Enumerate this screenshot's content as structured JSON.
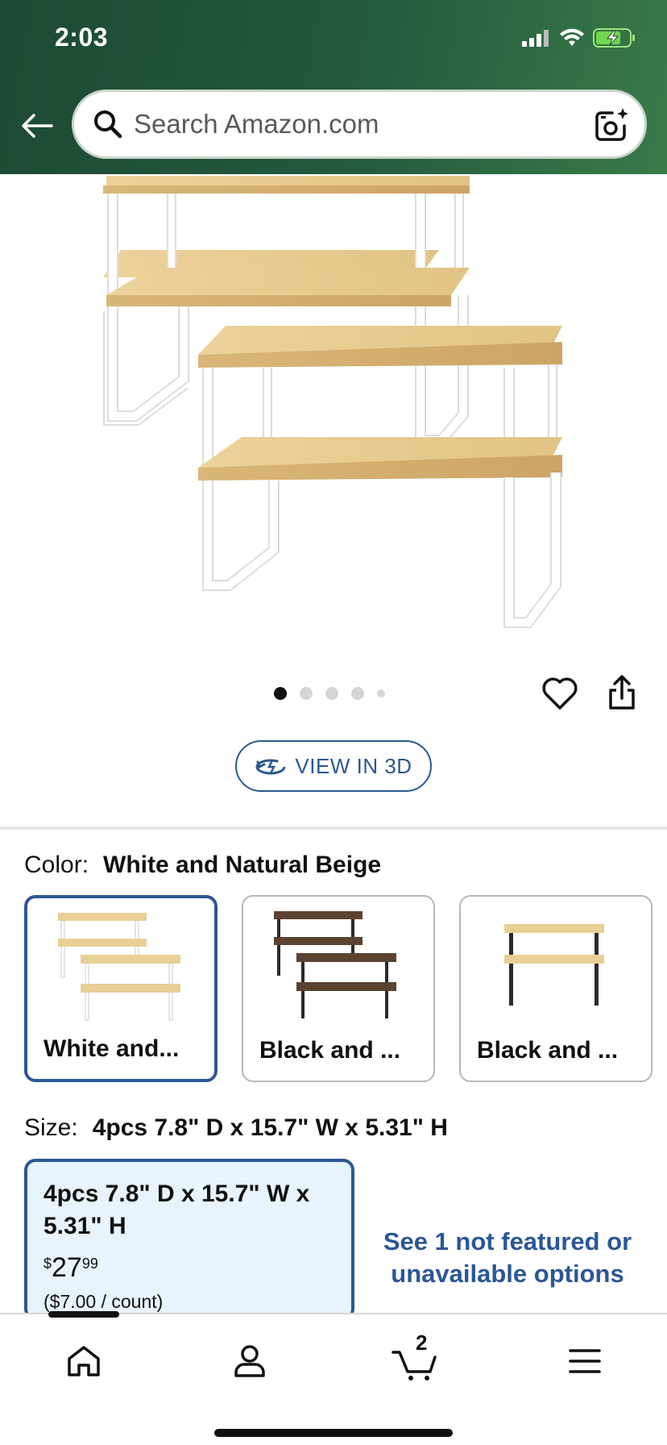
{
  "status_bar": {
    "time": "2:03"
  },
  "search": {
    "placeholder": "Search Amazon.com"
  },
  "product": {
    "image_alt": "Stackable kitchen cabinet shelf organizers, white and natural beige",
    "carousel": {
      "total": 5,
      "active": 1
    }
  },
  "actions": {
    "view_3d_label": "VIEW IN 3D"
  },
  "color": {
    "label": "Color:",
    "selected": "White and Natural Beige",
    "options": [
      {
        "label": "White and...",
        "wood": "#e8cf96",
        "frame": "#ffffff"
      },
      {
        "label": "Black and ...",
        "wood": "#5b4331",
        "frame": "#2a2a2a"
      },
      {
        "label": "Black and ...",
        "wood": "#e8cf96",
        "frame": "#2a2a2a"
      }
    ]
  },
  "size": {
    "label": "Size:",
    "selected": "4pcs 7.8\" D x 15.7\" W x 5.31\" H",
    "card": {
      "name": "4pcs 7.8\" D x 15.7\" W x 5.31\" H",
      "price_symbol": "$",
      "price_whole": "27",
      "price_fraction": "99",
      "unit_price": "($7.00 / count)"
    },
    "see_more": "See 1 not featured or unavailable options"
  },
  "tabbar": {
    "items": [
      "home",
      "account",
      "cart",
      "menu"
    ],
    "cart_count": "2"
  },
  "colors": {
    "header_green": "#245a3f",
    "link_blue": "#2b5796",
    "selected_bg": "#e7f3fd"
  }
}
